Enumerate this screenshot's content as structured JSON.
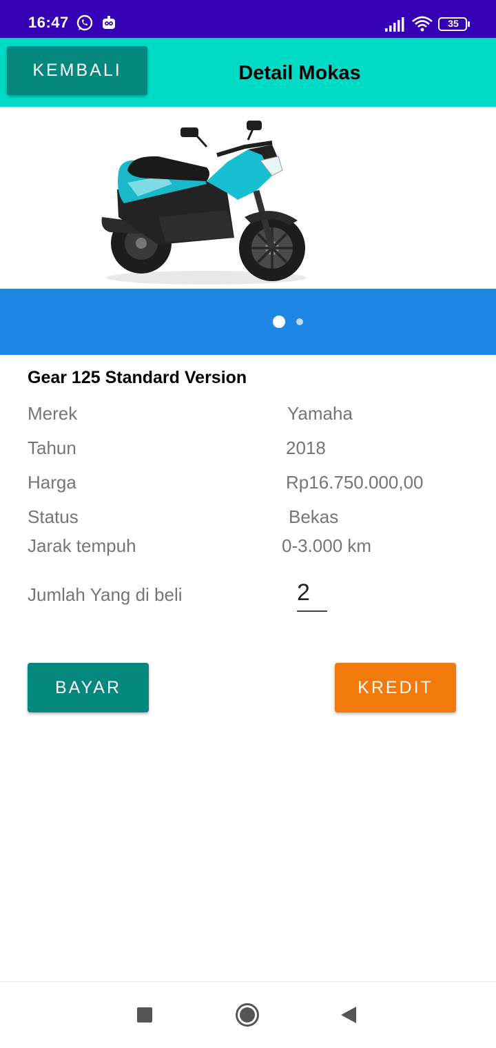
{
  "status_bar": {
    "time": "16:47",
    "battery": "35",
    "icons": [
      "whatsapp-icon",
      "bot-icon",
      "signal-icon",
      "wifi-icon",
      "battery-icon"
    ]
  },
  "toolbar": {
    "back_label": "KEMBALI",
    "title": "Detail Mokas"
  },
  "slider": {
    "dots_count": 2,
    "active_index": 0
  },
  "product": {
    "name": "Gear 125 Standard Version",
    "rows": [
      {
        "label": "Merek",
        "value": "Yamaha"
      },
      {
        "label": "Tahun",
        "value": "2018"
      },
      {
        "label": "Harga",
        "value": "Rp16.750.000,00"
      },
      {
        "label": "Status",
        "value": "Bekas"
      },
      {
        "label": "Jarak tempuh",
        "value": "0-3.000 km"
      }
    ],
    "qty_label": "Jumlah Yang di beli",
    "qty_value": "2"
  },
  "actions": {
    "pay_label": "BAYAR",
    "credit_label": "KREDIT"
  },
  "colors": {
    "status_bar": "#3600b4",
    "toolbar": "#00dbc6",
    "teal_button": "#04877c",
    "slider_bar": "#1e87e4",
    "credit_button": "#f27a0d"
  },
  "nav": {
    "icons": [
      "recent-apps-icon",
      "home-icon",
      "back-icon"
    ]
  }
}
